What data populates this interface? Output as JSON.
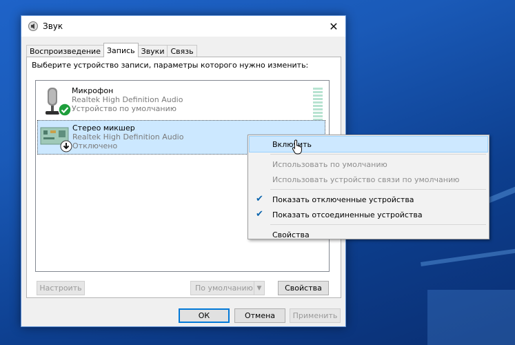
{
  "window": {
    "title": "Звук",
    "close_glyph": "✕"
  },
  "tabs": [
    {
      "label": "Воспроизведение",
      "active": false
    },
    {
      "label": "Запись",
      "active": true
    },
    {
      "label": "Звуки",
      "active": false
    },
    {
      "label": "Связь",
      "active": false
    }
  ],
  "panel": {
    "prompt": "Выберите устройство записи, параметры которого нужно изменить:"
  },
  "devices": [
    {
      "name": "Микрофон",
      "driver": "Realtek High Definition Audio",
      "status": "Устройство по умолчанию",
      "icon": "microphone-icon",
      "badge": "default-check-icon"
    },
    {
      "name": "Стерео микшер",
      "driver": "Realtek High Definition Audio",
      "status": "Отключено",
      "icon": "stereo-mixer-icon",
      "badge": "disabled-arrow-icon"
    }
  ],
  "buttons": {
    "configure": "Настроить",
    "set_default": "По умолчанию",
    "properties": "Свойства",
    "ok": "ОК",
    "cancel": "Отмена",
    "apply": "Применить"
  },
  "context_menu": {
    "items": [
      {
        "label": "Включить",
        "state": "highlighted"
      },
      {
        "label": "Использовать по умолчанию",
        "state": "disabled"
      },
      {
        "label": "Использовать устройство связи по умолчанию",
        "state": "disabled"
      },
      {
        "label": "Показать отключенные устройства",
        "state": "checked"
      },
      {
        "label": "Показать отсоединенные устройства",
        "state": "checked"
      },
      {
        "label": "Свойства",
        "state": "normal"
      }
    ]
  },
  "colors": {
    "selection": "#cce8ff",
    "accent": "#0078d7",
    "default_badge": "#1e9e3c"
  }
}
